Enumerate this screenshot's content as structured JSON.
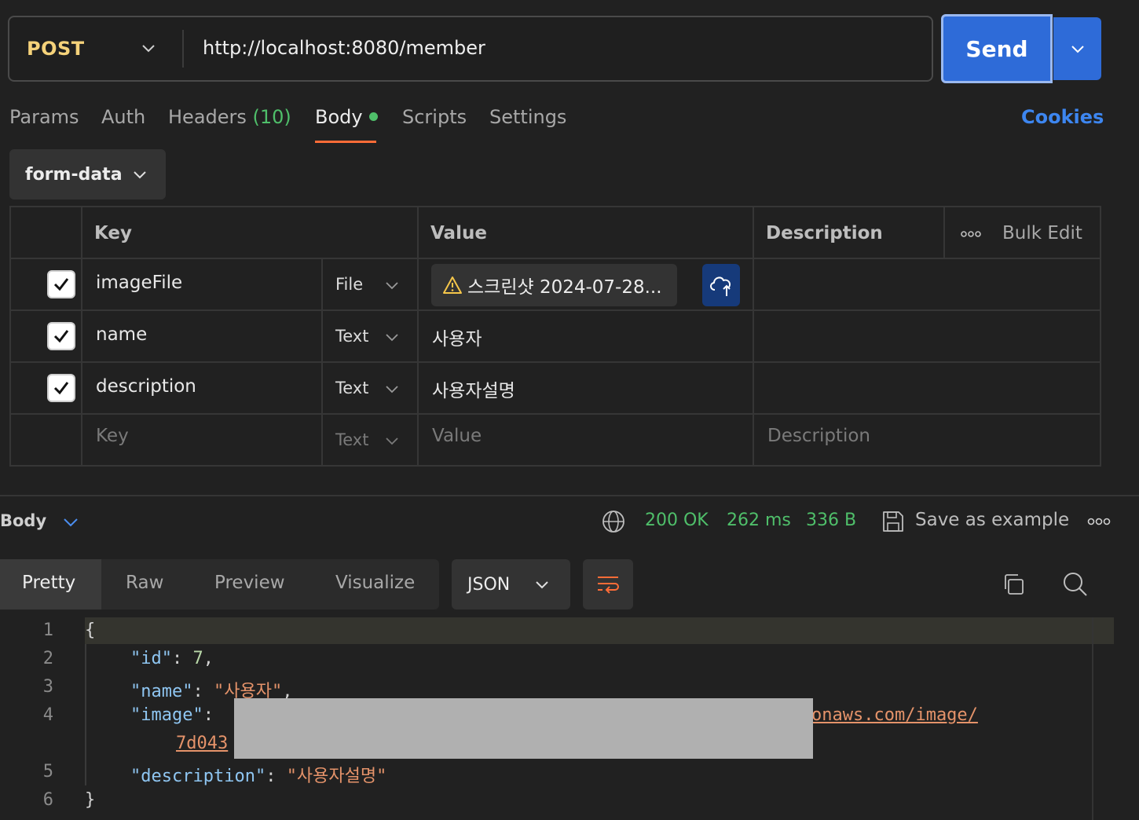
{
  "request": {
    "method": "POST",
    "url": "http://localhost:8080/member",
    "send_label": "Send"
  },
  "tabs": {
    "params": "Params",
    "auth": "Auth",
    "headers": "Headers",
    "headers_count": "(10)",
    "body": "Body",
    "scripts": "Scripts",
    "settings": "Settings",
    "cookies": "Cookies"
  },
  "body_mode": "form-data",
  "table": {
    "headers": {
      "key": "Key",
      "value": "Value",
      "description": "Description",
      "bulk_edit": "Bulk Edit"
    },
    "rows": [
      {
        "key": "imageFile",
        "type": "File",
        "value": "스크린샷 2024-07-28...",
        "checked": true
      },
      {
        "key": "name",
        "type": "Text",
        "value": "사용자",
        "checked": true
      },
      {
        "key": "description",
        "type": "Text",
        "value": "사용자설명",
        "checked": true
      }
    ],
    "placeholder": {
      "key": "Key",
      "type": "Text",
      "value": "Value",
      "description": "Description"
    }
  },
  "response": {
    "section_label": "Body",
    "status": "200 OK",
    "time": "262 ms",
    "size": "336 B",
    "save_example": "Save as example",
    "views": [
      "Pretty",
      "Raw",
      "Preview",
      "Visualize"
    ],
    "format": "JSON",
    "code": {
      "line_numbers": [
        "1",
        "2",
        "3",
        "4",
        "5",
        "6"
      ],
      "open_brace": "{",
      "close_brace": "}",
      "id_key": "\"id\"",
      "id_value": "7",
      "name_key": "\"name\"",
      "name_value": "\"사용자\"",
      "image_key": "\"image\"",
      "image_value_tail": "onaws.com/image/",
      "image_value_cont": "7d043",
      "description_key": "\"description\"",
      "description_value": "\"사용자설명\""
    }
  },
  "colors": {
    "accent_orange": "#ff6c37",
    "send_blue": "#2e6bd8",
    "status_green": "#4fbf6a",
    "method_yellow": "#f5d27a"
  }
}
